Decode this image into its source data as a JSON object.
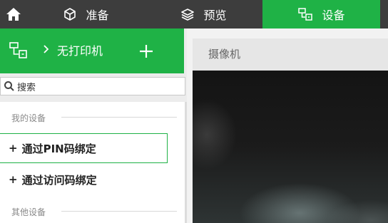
{
  "nav": {
    "tabs": [
      {
        "label": "准备",
        "icon": "cube-icon"
      },
      {
        "label": "预览",
        "icon": "layers-icon"
      },
      {
        "label": "设备",
        "icon": "device-network-icon"
      }
    ],
    "active_tab": "设备",
    "active_color": "#1fb246"
  },
  "sidebar": {
    "printer_label": "无打印机",
    "search_placeholder": "搜索",
    "section_my_devices": "我的设备",
    "items": [
      {
        "label": "通过PIN码绑定"
      },
      {
        "label": "通过访问码绑定"
      }
    ],
    "section_other_devices": "其他设备"
  },
  "camera": {
    "title": "摄像机"
  }
}
